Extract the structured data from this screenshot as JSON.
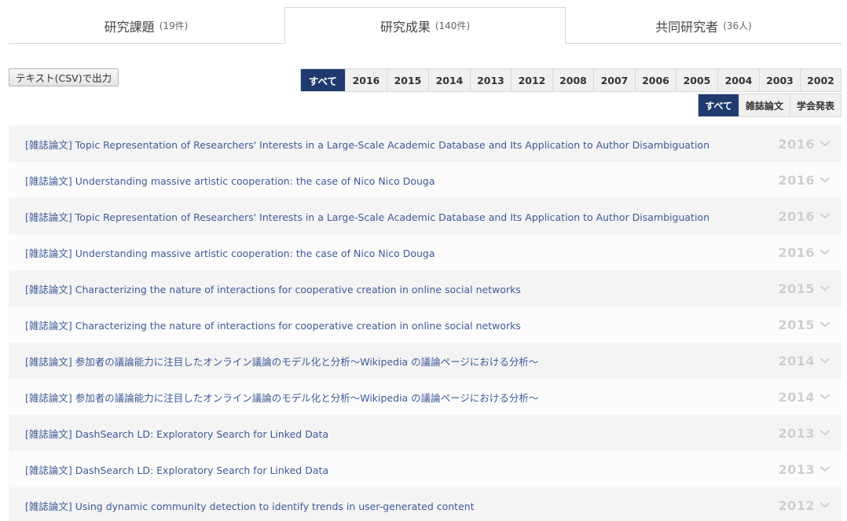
{
  "tabs": [
    {
      "label": "研究課題",
      "count": "(19件)",
      "active": false
    },
    {
      "label": "研究成果",
      "count": "(140件)",
      "active": true
    },
    {
      "label": "共同研究者",
      "count": "(36人)",
      "active": false
    }
  ],
  "csv_button": "テキスト(CSV)で出力",
  "year_filters": [
    {
      "label": "すべて",
      "active": true,
      "width": 56
    },
    {
      "label": "2016",
      "width": 53
    },
    {
      "label": "2015",
      "width": 53
    },
    {
      "label": "2014",
      "width": 53
    },
    {
      "label": "2013",
      "width": 52
    },
    {
      "label": "2012",
      "width": 53
    },
    {
      "label": "2008",
      "width": 52
    },
    {
      "label": "2007",
      "width": 53
    },
    {
      "label": "2006",
      "width": 52
    },
    {
      "label": "2005",
      "width": 53
    },
    {
      "label": "2004",
      "width": 53
    },
    {
      "label": "2003",
      "width": 52
    },
    {
      "label": "2002",
      "width": 52
    }
  ],
  "type_filters": [
    {
      "label": "すべて",
      "active": true
    },
    {
      "label": "雑誌論文"
    },
    {
      "label": "学会発表"
    }
  ],
  "results": [
    {
      "type": "[雑誌論文]",
      "title": "Topic Representation of Researchers' Interests in a Large-Scale Academic Database and Its Application to Author Disambiguation",
      "year": "2016"
    },
    {
      "type": "[雑誌論文]",
      "title": "Understanding massive artistic cooperation: the case of Nico Nico Douga",
      "year": "2016"
    },
    {
      "type": "[雑誌論文]",
      "title": "Topic Representation of Researchers' Interests in a Large-Scale Academic Database and Its Application to Author Disambiguation",
      "year": "2016"
    },
    {
      "type": "[雑誌論文]",
      "title": "Understanding massive artistic cooperation: the case of Nico Nico Douga",
      "year": "2016"
    },
    {
      "type": "[雑誌論文]",
      "title": "Characterizing the nature of interactions for cooperative creation in online social networks",
      "year": "2015"
    },
    {
      "type": "[雑誌論文]",
      "title": "Characterizing the nature of interactions for cooperative creation in online social networks",
      "year": "2015"
    },
    {
      "type": "[雑誌論文]",
      "title": "参加者の議論能力に注目したオンライン議論のモデル化と分析〜Wikipedia の議論ページにおける分析〜",
      "year": "2014"
    },
    {
      "type": "[雑誌論文]",
      "title": "参加者の議論能力に注目したオンライン議論のモデル化と分析〜Wikipedia の議論ページにおける分析〜",
      "year": "2014"
    },
    {
      "type": "[雑誌論文]",
      "title": "DashSearch LD: Exploratory Search for Linked Data",
      "year": "2013"
    },
    {
      "type": "[雑誌論文]",
      "title": "DashSearch LD: Exploratory Search for Linked Data",
      "year": "2013"
    },
    {
      "type": "[雑誌論文]",
      "title": "Using dynamic community detection to identify trends in user-generated content",
      "year": "2012"
    }
  ],
  "colors": {
    "accent": "#1f3a6e",
    "link": "#3c5a9a",
    "year_muted": "#cfcfcf"
  }
}
